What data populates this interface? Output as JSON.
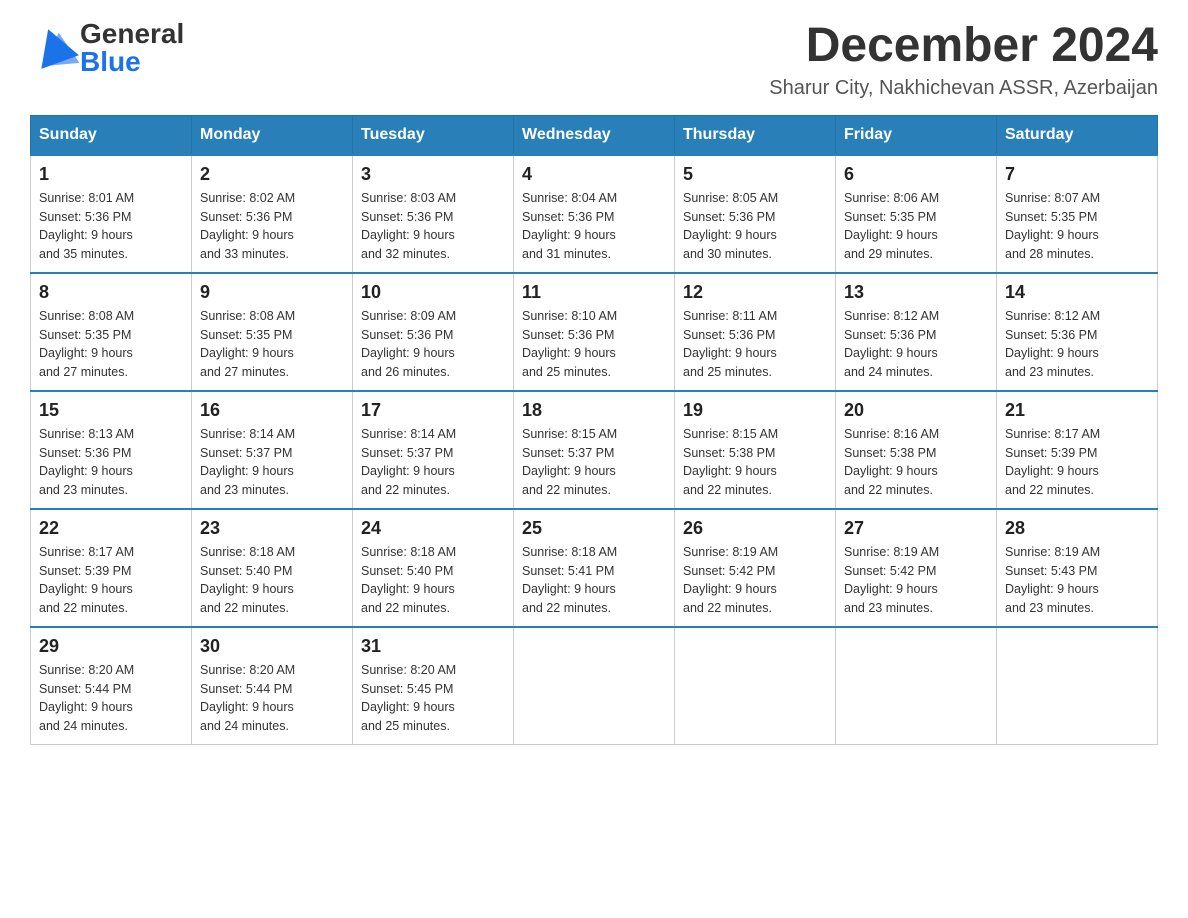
{
  "header": {
    "logo": {
      "general": "General",
      "blue": "Blue",
      "alt": "GeneralBlue logo"
    },
    "title": "December 2024",
    "location": "Sharur City, Nakhichevan ASSR, Azerbaijan"
  },
  "days_of_week": [
    "Sunday",
    "Monday",
    "Tuesday",
    "Wednesday",
    "Thursday",
    "Friday",
    "Saturday"
  ],
  "weeks": [
    [
      {
        "day": "1",
        "sunrise": "8:01 AM",
        "sunset": "5:36 PM",
        "daylight": "9 hours and 35 minutes."
      },
      {
        "day": "2",
        "sunrise": "8:02 AM",
        "sunset": "5:36 PM",
        "daylight": "9 hours and 33 minutes."
      },
      {
        "day": "3",
        "sunrise": "8:03 AM",
        "sunset": "5:36 PM",
        "daylight": "9 hours and 32 minutes."
      },
      {
        "day": "4",
        "sunrise": "8:04 AM",
        "sunset": "5:36 PM",
        "daylight": "9 hours and 31 minutes."
      },
      {
        "day": "5",
        "sunrise": "8:05 AM",
        "sunset": "5:36 PM",
        "daylight": "9 hours and 30 minutes."
      },
      {
        "day": "6",
        "sunrise": "8:06 AM",
        "sunset": "5:35 PM",
        "daylight": "9 hours and 29 minutes."
      },
      {
        "day": "7",
        "sunrise": "8:07 AM",
        "sunset": "5:35 PM",
        "daylight": "9 hours and 28 minutes."
      }
    ],
    [
      {
        "day": "8",
        "sunrise": "8:08 AM",
        "sunset": "5:35 PM",
        "daylight": "9 hours and 27 minutes."
      },
      {
        "day": "9",
        "sunrise": "8:08 AM",
        "sunset": "5:35 PM",
        "daylight": "9 hours and 27 minutes."
      },
      {
        "day": "10",
        "sunrise": "8:09 AM",
        "sunset": "5:36 PM",
        "daylight": "9 hours and 26 minutes."
      },
      {
        "day": "11",
        "sunrise": "8:10 AM",
        "sunset": "5:36 PM",
        "daylight": "9 hours and 25 minutes."
      },
      {
        "day": "12",
        "sunrise": "8:11 AM",
        "sunset": "5:36 PM",
        "daylight": "9 hours and 25 minutes."
      },
      {
        "day": "13",
        "sunrise": "8:12 AM",
        "sunset": "5:36 PM",
        "daylight": "9 hours and 24 minutes."
      },
      {
        "day": "14",
        "sunrise": "8:12 AM",
        "sunset": "5:36 PM",
        "daylight": "9 hours and 23 minutes."
      }
    ],
    [
      {
        "day": "15",
        "sunrise": "8:13 AM",
        "sunset": "5:36 PM",
        "daylight": "9 hours and 23 minutes."
      },
      {
        "day": "16",
        "sunrise": "8:14 AM",
        "sunset": "5:37 PM",
        "daylight": "9 hours and 23 minutes."
      },
      {
        "day": "17",
        "sunrise": "8:14 AM",
        "sunset": "5:37 PM",
        "daylight": "9 hours and 22 minutes."
      },
      {
        "day": "18",
        "sunrise": "8:15 AM",
        "sunset": "5:37 PM",
        "daylight": "9 hours and 22 minutes."
      },
      {
        "day": "19",
        "sunrise": "8:15 AM",
        "sunset": "5:38 PM",
        "daylight": "9 hours and 22 minutes."
      },
      {
        "day": "20",
        "sunrise": "8:16 AM",
        "sunset": "5:38 PM",
        "daylight": "9 hours and 22 minutes."
      },
      {
        "day": "21",
        "sunrise": "8:17 AM",
        "sunset": "5:39 PM",
        "daylight": "9 hours and 22 minutes."
      }
    ],
    [
      {
        "day": "22",
        "sunrise": "8:17 AM",
        "sunset": "5:39 PM",
        "daylight": "9 hours and 22 minutes."
      },
      {
        "day": "23",
        "sunrise": "8:18 AM",
        "sunset": "5:40 PM",
        "daylight": "9 hours and 22 minutes."
      },
      {
        "day": "24",
        "sunrise": "8:18 AM",
        "sunset": "5:40 PM",
        "daylight": "9 hours and 22 minutes."
      },
      {
        "day": "25",
        "sunrise": "8:18 AM",
        "sunset": "5:41 PM",
        "daylight": "9 hours and 22 minutes."
      },
      {
        "day": "26",
        "sunrise": "8:19 AM",
        "sunset": "5:42 PM",
        "daylight": "9 hours and 22 minutes."
      },
      {
        "day": "27",
        "sunrise": "8:19 AM",
        "sunset": "5:42 PM",
        "daylight": "9 hours and 23 minutes."
      },
      {
        "day": "28",
        "sunrise": "8:19 AM",
        "sunset": "5:43 PM",
        "daylight": "9 hours and 23 minutes."
      }
    ],
    [
      {
        "day": "29",
        "sunrise": "8:20 AM",
        "sunset": "5:44 PM",
        "daylight": "9 hours and 24 minutes."
      },
      {
        "day": "30",
        "sunrise": "8:20 AM",
        "sunset": "5:44 PM",
        "daylight": "9 hours and 24 minutes."
      },
      {
        "day": "31",
        "sunrise": "8:20 AM",
        "sunset": "5:45 PM",
        "daylight": "9 hours and 25 minutes."
      },
      null,
      null,
      null,
      null
    ]
  ],
  "labels": {
    "sunrise": "Sunrise:",
    "sunset": "Sunset:",
    "daylight": "Daylight:"
  }
}
